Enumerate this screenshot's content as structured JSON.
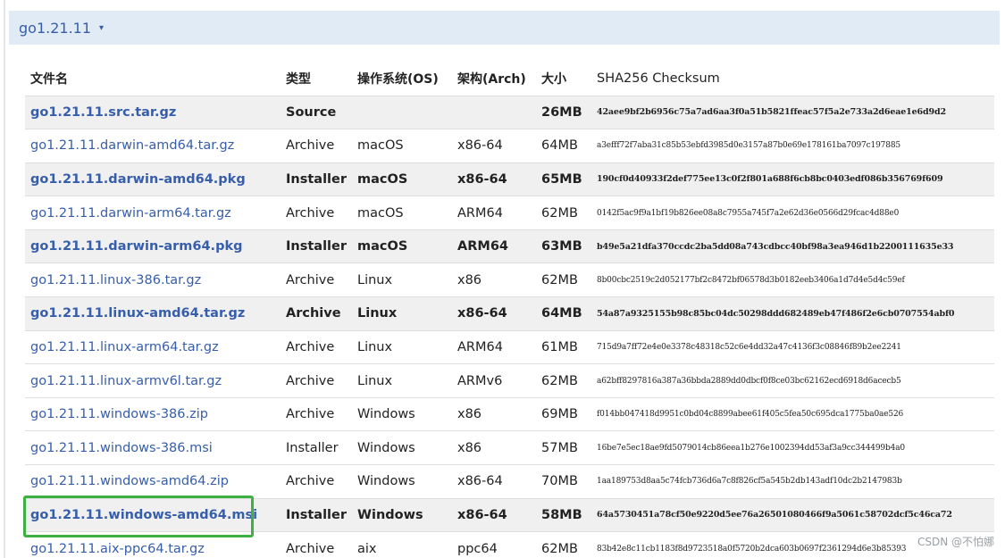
{
  "version": {
    "label": "go1.21.11",
    "caret": "▾"
  },
  "table": {
    "headers": {
      "filename": "文件名",
      "kind": "类型",
      "os": "操作系统(OS)",
      "arch": "架构(Arch)",
      "size": "大小",
      "checksum": "SHA256 Checksum"
    },
    "rows": [
      {
        "name": "go1.21.11.src.tar.gz",
        "kind": "Source",
        "os": "",
        "arch": "",
        "size": "26MB",
        "sha": "42aee9bf2b6956c75a7ad6aa3f0a51b5821ffeac57f5a2e733a2d6eae1e6d9d2",
        "highlight": true
      },
      {
        "name": "go1.21.11.darwin-amd64.tar.gz",
        "kind": "Archive",
        "os": "macOS",
        "arch": "x86-64",
        "size": "64MB",
        "sha": "a3efff72f7aba31c85b53ebfd3985d0e3157a87b0e69e178161ba7097c197885",
        "highlight": false
      },
      {
        "name": "go1.21.11.darwin-amd64.pkg",
        "kind": "Installer",
        "os": "macOS",
        "arch": "x86-64",
        "size": "65MB",
        "sha": "190cf0d40933f2def775ee13c0f2f801a688f6cb8bc0403edf086b356769f609",
        "highlight": true
      },
      {
        "name": "go1.21.11.darwin-arm64.tar.gz",
        "kind": "Archive",
        "os": "macOS",
        "arch": "ARM64",
        "size": "62MB",
        "sha": "0142f5ac9f9a1bf19b826ee08a8c7955a745f7a2e62d36e0566d29fcac4d88e0",
        "highlight": false
      },
      {
        "name": "go1.21.11.darwin-arm64.pkg",
        "kind": "Installer",
        "os": "macOS",
        "arch": "ARM64",
        "size": "63MB",
        "sha": "b49e5a21dfa370ccdc2ba5dd08a743cdbcc40bf98a3ea946d1b2200111635e33",
        "highlight": true
      },
      {
        "name": "go1.21.11.linux-386.tar.gz",
        "kind": "Archive",
        "os": "Linux",
        "arch": "x86",
        "size": "62MB",
        "sha": "8b00cbc2519c2d052177bf2c8472bf06578d3b0182eeb3406a1d7d4e5d4c59ef",
        "highlight": false
      },
      {
        "name": "go1.21.11.linux-amd64.tar.gz",
        "kind": "Archive",
        "os": "Linux",
        "arch": "x86-64",
        "size": "64MB",
        "sha": "54a87a9325155b98c85bc04dc50298ddd682489eb47f486f2e6cb0707554abf0",
        "highlight": true
      },
      {
        "name": "go1.21.11.linux-arm64.tar.gz",
        "kind": "Archive",
        "os": "Linux",
        "arch": "ARM64",
        "size": "61MB",
        "sha": "715d9a7ff72e4e0e3378c48318c52c6e4dd32a47c4136f3c08846f89b2ee2241",
        "highlight": false
      },
      {
        "name": "go1.21.11.linux-armv6l.tar.gz",
        "kind": "Archive",
        "os": "Linux",
        "arch": "ARMv6",
        "size": "62MB",
        "sha": "a62bff8297816a387a36bbda2889dd0dbcf0f8ce03bc62162ecd6918d6acecb5",
        "highlight": false
      },
      {
        "name": "go1.21.11.windows-386.zip",
        "kind": "Archive",
        "os": "Windows",
        "arch": "x86",
        "size": "69MB",
        "sha": "f014bb047418d9951c0bd04c8899abee61f405c5fea50c695dca1775ba0ae526",
        "highlight": false
      },
      {
        "name": "go1.21.11.windows-386.msi",
        "kind": "Installer",
        "os": "Windows",
        "arch": "x86",
        "size": "57MB",
        "sha": "16be7e5ec18ae9fd5079014cb86eea1b276e1002394dd53af3a9cc344499b4a0",
        "highlight": false
      },
      {
        "name": "go1.21.11.windows-amd64.zip",
        "kind": "Archive",
        "os": "Windows",
        "arch": "x86-64",
        "size": "70MB",
        "sha": "1aa189753d8aa5c74fcb736d6a7c8f826cf5a545b2db143adf10dc2b2147983b",
        "highlight": false
      },
      {
        "name": "go1.21.11.windows-amd64.msi",
        "kind": "Installer",
        "os": "Windows",
        "arch": "x86-64",
        "size": "58MB",
        "sha": "64a5730451a78cf50e9220d5ee76a26501080466f9a5061c58702dcf5c46ca72",
        "highlight": true
      },
      {
        "name": "go1.21.11.aix-ppc64.tar.gz",
        "kind": "Archive",
        "os": "aix",
        "arch": "ppc64",
        "size": "62MB",
        "sha": "83b42e8c11cb1183f8d9723518a0f5720b2dca603b0697f2361294d6e3b85393",
        "highlight": false
      }
    ]
  },
  "watermark": "CSDN @不怕娜",
  "colors": {
    "link": "#375eab",
    "version_bar": "#e0ebf5",
    "selection_outline": "#3cb043",
    "row_highlight": "#f0f0f0"
  }
}
